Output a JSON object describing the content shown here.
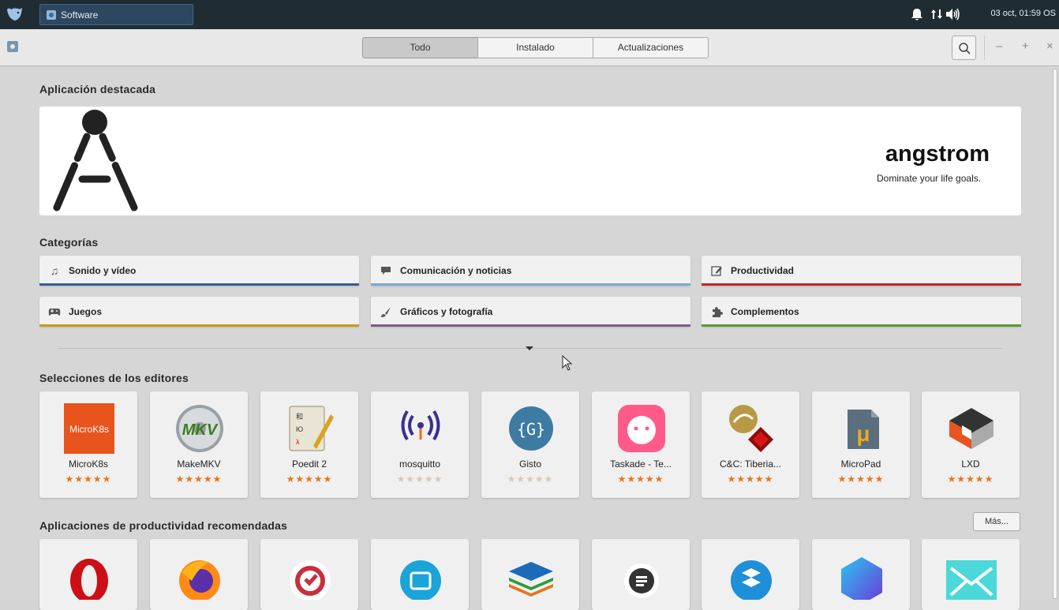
{
  "panel": {
    "task_label": "Software",
    "clock": "03 oct, 01:59 OS"
  },
  "header": {
    "tabs": [
      {
        "label": "Todo",
        "active": true
      },
      {
        "label": "Instalado",
        "active": false
      },
      {
        "label": "Actualizaciones",
        "active": false
      }
    ]
  },
  "featured": {
    "section_title": "Aplicación destacada",
    "app_name": "angstrom",
    "tagline": "Dominate your life goals."
  },
  "categories": {
    "section_title": "Categorías",
    "items": [
      {
        "label": "Sonido y vídeo",
        "icon": "music-note-icon",
        "color": "#2f5f9e"
      },
      {
        "label": "Comunicación y noticias",
        "icon": "speech-bubble-icon",
        "color": "#7fa6d4"
      },
      {
        "label": "Productividad",
        "icon": "edit-icon",
        "color": "#c0262d"
      },
      {
        "label": "Juegos",
        "icon": "gamepad-icon",
        "color": "#c99a1e"
      },
      {
        "label": "Gráficos y fotografía",
        "icon": "brush-icon",
        "color": "#7a5c86"
      },
      {
        "label": "Complementos",
        "icon": "puzzle-icon",
        "color": "#5e9a2f"
      }
    ]
  },
  "editors_picks": {
    "section_title": "Selecciones de los editores",
    "apps": [
      {
        "name": "MicroK8s",
        "icon": "microk8s-icon",
        "rated": true
      },
      {
        "name": "MakeMKV",
        "icon": "makemkv-icon",
        "rated": true
      },
      {
        "name": "Poedit 2",
        "icon": "poedit-icon",
        "rated": true
      },
      {
        "name": "mosquitto",
        "icon": "mosquitto-icon",
        "rated": false
      },
      {
        "name": "Gisto",
        "icon": "gisto-icon",
        "rated": false
      },
      {
        "name": "Taskade - Te...",
        "icon": "taskade-icon",
        "rated": true
      },
      {
        "name": "C&C: Tiberia...",
        "icon": "cnc-tiberian-icon",
        "rated": true
      },
      {
        "name": "MicroPad",
        "icon": "micropad-icon",
        "rated": true
      },
      {
        "name": "LXD",
        "icon": "lxd-icon",
        "rated": true
      }
    ],
    "stars": "★★★★★",
    "star_color_rated": "#e8731e",
    "star_color_unrated": "#d8c8b8"
  },
  "productivity": {
    "section_title": "Aplicaciones de productividad recomendadas",
    "more_label": "Más...",
    "apps": [
      {
        "icon": "opera-icon"
      },
      {
        "icon": "firefox-icon"
      },
      {
        "icon": "ticktick-icon"
      },
      {
        "icon": "screen-icon"
      },
      {
        "icon": "layers-icon"
      },
      {
        "icon": "beeper-icon"
      },
      {
        "icon": "dropbox-style-icon"
      },
      {
        "icon": "hexagon-icon"
      },
      {
        "icon": "mail-icon"
      }
    ]
  }
}
